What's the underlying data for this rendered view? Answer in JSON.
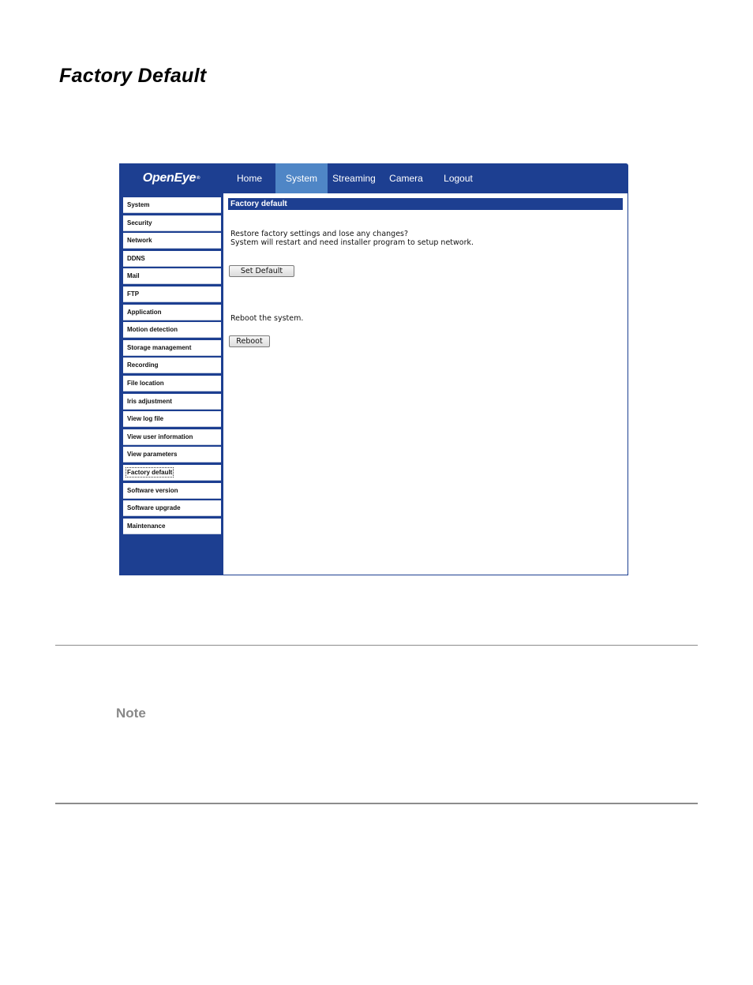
{
  "document": {
    "title": "Factory Default",
    "note_label": "Note"
  },
  "app": {
    "logo": "OpenEye",
    "logo_mark": "®",
    "nav": [
      {
        "label": "Home",
        "active": false
      },
      {
        "label": "System",
        "active": true
      },
      {
        "label": "Streaming",
        "active": false
      },
      {
        "label": "Camera",
        "active": false
      },
      {
        "label": "Logout",
        "active": false
      }
    ],
    "sidebar": [
      {
        "label": "System"
      },
      {
        "label": "Security"
      },
      {
        "label": "Network"
      },
      {
        "label": "DDNS"
      },
      {
        "label": "Mail"
      },
      {
        "label": "FTP"
      },
      {
        "label": "Application"
      },
      {
        "label": "Motion detection"
      },
      {
        "label": "Storage management"
      },
      {
        "label": "Recording"
      },
      {
        "label": "File location"
      },
      {
        "label": "Iris adjustment"
      },
      {
        "label": "View log file"
      },
      {
        "label": "View user information"
      },
      {
        "label": "View parameters"
      },
      {
        "label": "Factory default"
      },
      {
        "label": "Software version"
      },
      {
        "label": "Software upgrade"
      },
      {
        "label": "Maintenance"
      }
    ],
    "current_sidebar_item": "Factory default",
    "content": {
      "section_title": "Factory default",
      "restore_line1": "Restore factory settings and lose any changes?",
      "restore_line2": "System will restart and need installer program to setup network.",
      "set_default_label": "Set Default",
      "reboot_text": "Reboot the system.",
      "reboot_label": "Reboot"
    },
    "colors": {
      "primary": "#1d3f91",
      "active_tab": "#4f86c6"
    }
  }
}
